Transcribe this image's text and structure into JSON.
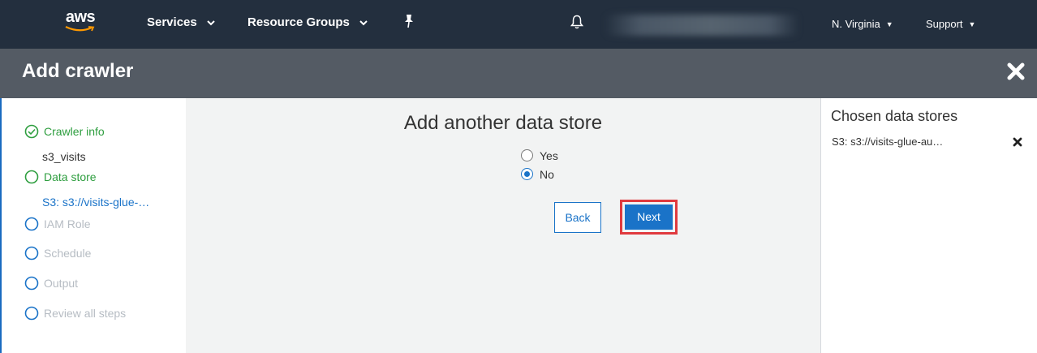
{
  "topnav": {
    "logo_text": "aws",
    "services_label": "Services",
    "resource_groups_label": "Resource Groups",
    "region_label": "N. Virginia",
    "support_label": "Support",
    "pin_icon": "pin-icon",
    "bell_icon": "bell-icon"
  },
  "header": {
    "title": "Add crawler",
    "close_icon": "close-icon"
  },
  "steps": [
    {
      "label": "Crawler info",
      "state": "done",
      "sub": "s3_visits"
    },
    {
      "label": "Data store",
      "state": "active",
      "sub": "S3: s3://visits-glue-…"
    },
    {
      "label": "IAM Role",
      "state": "disabled"
    },
    {
      "label": "Schedule",
      "state": "disabled"
    },
    {
      "label": "Output",
      "state": "disabled"
    },
    {
      "label": "Review all steps",
      "state": "disabled"
    }
  ],
  "main": {
    "heading": "Add another data store",
    "options": [
      {
        "label": "Yes",
        "checked": false
      },
      {
        "label": "No",
        "checked": true
      }
    ],
    "back_label": "Back",
    "next_label": "Next"
  },
  "right_panel": {
    "title": "Chosen data stores",
    "stores": [
      "S3: s3://visits-glue-au…"
    ]
  },
  "colors": {
    "nav_bg": "#232f3e",
    "header_bg": "#545b64",
    "accent_blue": "#1a73c8",
    "step_green": "#2e9e3f",
    "highlight_red": "#e03a3e"
  }
}
